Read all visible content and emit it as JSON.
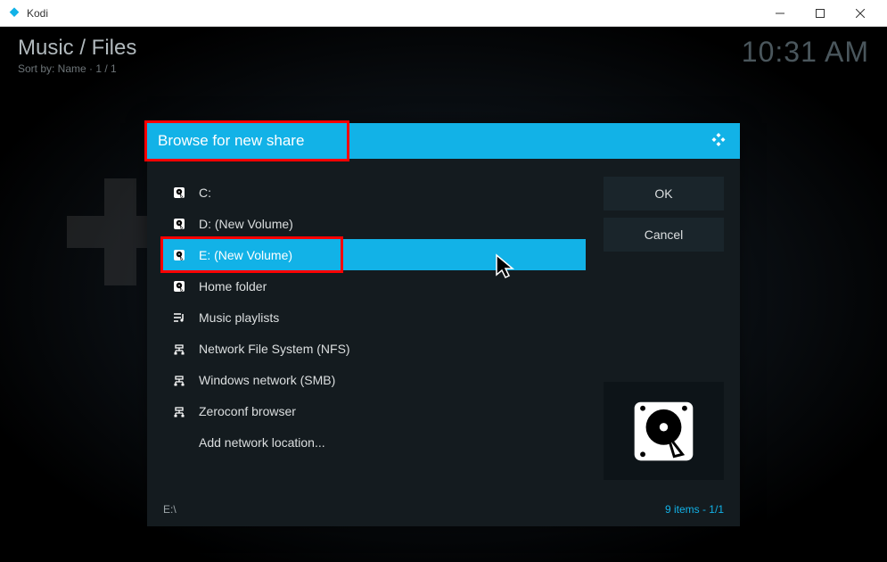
{
  "titlebar": {
    "app_name": "Kodi"
  },
  "backdrop": {
    "breadcrumb": "Music / Files",
    "sort_info": "Sort by: Name  ·  1 / 1",
    "clock": "10:31 AM"
  },
  "dialog": {
    "title": "Browse for new share",
    "items": [
      {
        "icon": "disk",
        "label": "C:"
      },
      {
        "icon": "disk",
        "label": "D: (New Volume)"
      },
      {
        "icon": "disk",
        "label": "E: (New Volume)",
        "selected": true,
        "highlighted": true
      },
      {
        "icon": "disk",
        "label": "Home folder"
      },
      {
        "icon": "playlist",
        "label": "Music playlists"
      },
      {
        "icon": "network",
        "label": "Network File System (NFS)"
      },
      {
        "icon": "network",
        "label": "Windows network (SMB)"
      },
      {
        "icon": "network",
        "label": "Zeroconf browser"
      },
      {
        "icon": "none",
        "label": "Add network location..."
      }
    ],
    "buttons": {
      "ok": "OK",
      "cancel": "Cancel"
    },
    "footer": {
      "path": "E:\\",
      "count_label": "9 items",
      "page": " - 1/1"
    }
  }
}
